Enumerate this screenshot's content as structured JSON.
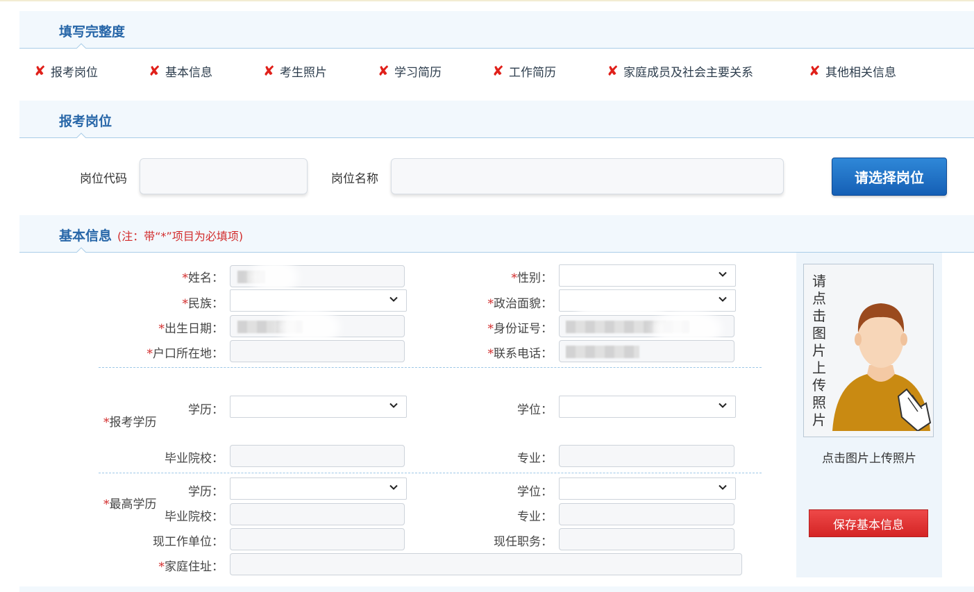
{
  "completeness": {
    "title": "填写完整度",
    "items": [
      {
        "label": "报考岗位",
        "status_icon": "x-mark-icon"
      },
      {
        "label": "基本信息",
        "status_icon": "x-mark-icon"
      },
      {
        "label": "考生照片",
        "status_icon": "x-mark-icon"
      },
      {
        "label": "学习简历",
        "status_icon": "x-mark-icon"
      },
      {
        "label": "工作简历",
        "status_icon": "x-mark-icon"
      },
      {
        "label": "家庭成员及社会主要关系",
        "status_icon": "x-mark-icon"
      },
      {
        "label": "其他相关信息",
        "status_icon": "x-mark-icon"
      }
    ]
  },
  "job": {
    "title": "报考岗位",
    "code_label": "岗位代码",
    "code_value": "",
    "name_label": "岗位名称",
    "name_value": "",
    "select_button": "请选择岗位"
  },
  "basic": {
    "title": "基本信息",
    "note": "(注：带“*”项目为必填项)",
    "required_mark": "*",
    "name_label": "姓名：",
    "gender_label": "性别：",
    "gender_value": "",
    "ethnicity_label": "民族：",
    "ethnicity_value": "",
    "political_label": "政治面貌：",
    "political_value": "",
    "birth_label": "出生日期：",
    "id_label": "身份证号：",
    "hukou_label": "户口所在地：",
    "hukou_value": "",
    "phone_label": "联系电话：",
    "exam_edu_group": "报考学历",
    "highest_edu_group": "最高学历",
    "edu_label": "学历：",
    "degree_label": "学位：",
    "school_label": "毕业院校：",
    "major_label": "专业：",
    "work_unit_label": "现工作单位：",
    "position_label": "现任职务：",
    "address_label": "家庭住址：",
    "save_button": "保存基本信息"
  },
  "photo": {
    "vertical_text": [
      "请",
      "点",
      "击",
      "图",
      "片",
      "上",
      "传",
      "照",
      "片"
    ],
    "caption": "点击图片上传照片",
    "icon": "avatar-upload-icon"
  },
  "colors": {
    "accent_blue": "#2766a8",
    "error_red": "#e0201a",
    "save_red": "#d42525",
    "button_blue": "#155fb5"
  }
}
